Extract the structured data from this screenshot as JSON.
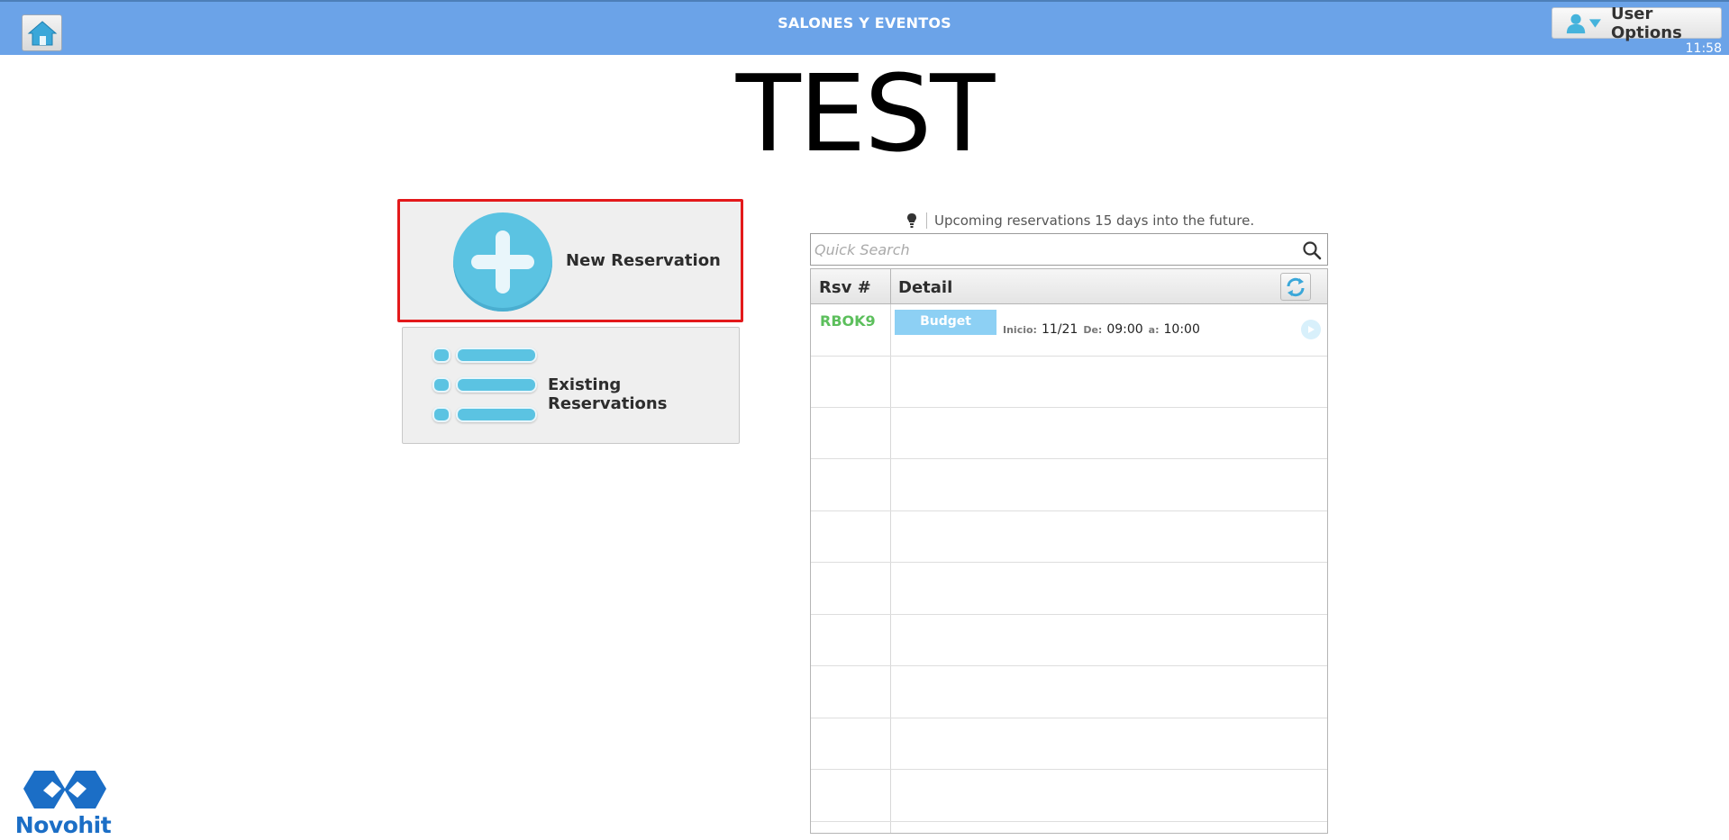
{
  "header": {
    "title": "SALONES Y EVENTOS",
    "user_options_label": "User Options",
    "time": "11:58"
  },
  "page": {
    "title": "TEST"
  },
  "actions": {
    "new_reservation_label": "New Reservation",
    "existing_reservations_label": "Existing Reservations"
  },
  "upcoming": {
    "info_text": "Upcoming reservations 15 days into the future.",
    "search_placeholder": "Quick Search",
    "columns": [
      "Rsv #",
      "Detail"
    ],
    "rows": [
      {
        "rsv": "RBOK9",
        "status": "Budget",
        "inicio_label": "Inicio:",
        "inicio": "11/21",
        "de_label": "De:",
        "de": "09:00",
        "a_label": "a:",
        "a": "10:00"
      }
    ]
  },
  "logo": {
    "text": "Novohit"
  },
  "colors": {
    "topbar": "#6ba3e8",
    "accent": "#5bc3e2",
    "highlight_border": "#e3191b",
    "rsv_id": "#5cbf5c",
    "badge": "#8dd0f4",
    "logo": "#1b6ec6"
  }
}
